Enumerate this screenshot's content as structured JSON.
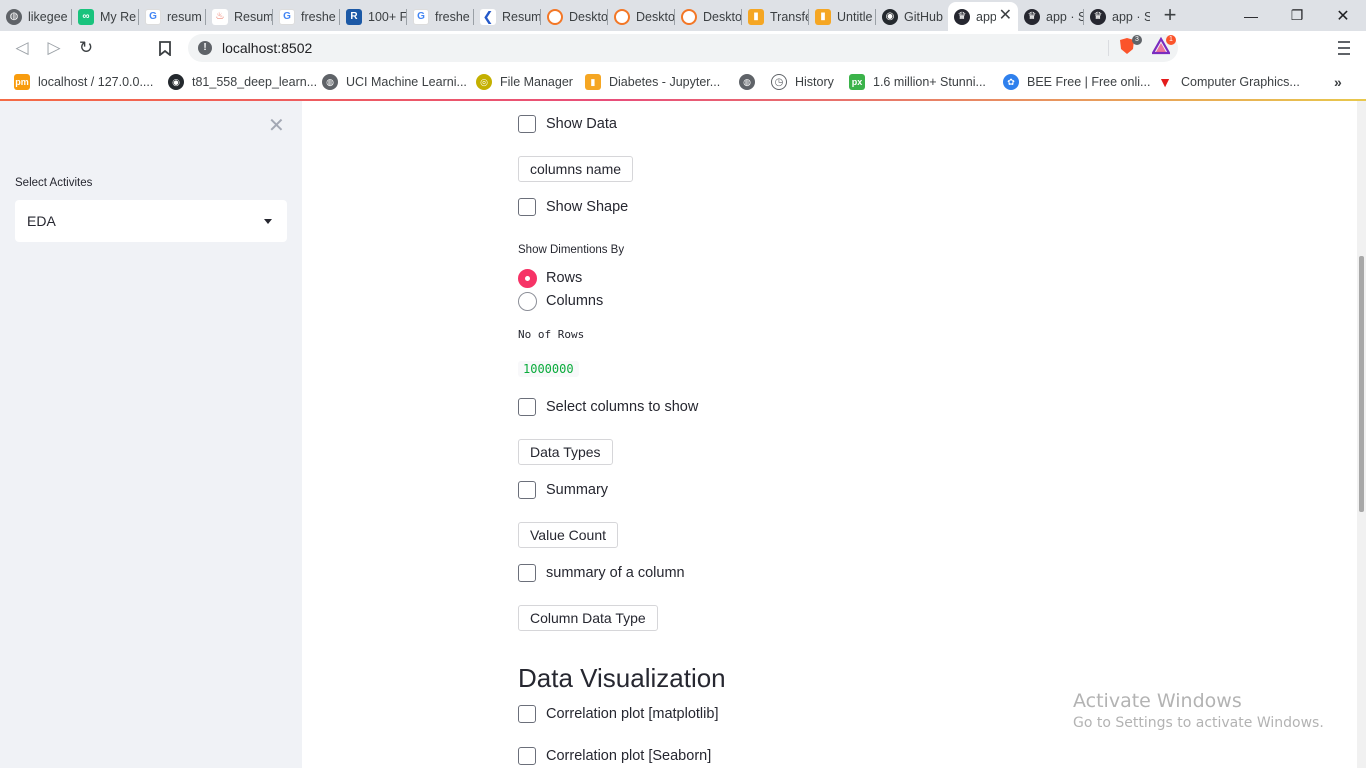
{
  "browser": {
    "tabs": [
      {
        "title": "likegee",
        "color": "#5f6368",
        "icon": "globe-icon"
      },
      {
        "title": "My Re",
        "color": "#19c37d",
        "icon": "infinity-icon"
      },
      {
        "title": "resum",
        "color": "#4285f4",
        "icon": "google-icon"
      },
      {
        "title": "Resum",
        "color": "#e5533d",
        "icon": "flame-icon"
      },
      {
        "title": "freshe",
        "color": "#4285f4",
        "icon": "google-icon"
      },
      {
        "title": "100+ F",
        "color": "#1c59a6",
        "icon": "r-icon"
      },
      {
        "title": "freshe",
        "color": "#4285f4",
        "icon": "google-icon"
      },
      {
        "title": "Resum",
        "color": "#2559c9",
        "icon": "k-icon"
      },
      {
        "title": "Deskto",
        "color": "#f37726",
        "icon": "jupyter-icon"
      },
      {
        "title": "Deskto",
        "color": "#f37726",
        "icon": "jupyter-icon"
      },
      {
        "title": "Deskto",
        "color": "#f37726",
        "icon": "jupyter-icon"
      },
      {
        "title": "Transfe",
        "color": "#f5a623",
        "icon": "notebook-icon"
      },
      {
        "title": "Untitle",
        "color": "#f5a623",
        "icon": "notebook-icon"
      },
      {
        "title": "GitHub",
        "color": "#24292e",
        "icon": "github-icon"
      },
      {
        "title": "app",
        "color": "#262730",
        "icon": "streamlit-icon"
      },
      {
        "title": "app · S",
        "color": "#262730",
        "icon": "streamlit-icon"
      },
      {
        "title": "app · S",
        "color": "#262730",
        "icon": "streamlit-icon"
      }
    ],
    "active_tab_index": 14,
    "url": "localhost:8502",
    "extensions": {
      "brave_badge": "3",
      "rewards_badge": "1"
    },
    "bookmarks": [
      {
        "label": "localhost / 127.0.0....",
        "color": "#f89c0e",
        "icon": "phpmyadmin-icon"
      },
      {
        "label": "t81_558_deep_learn...",
        "color": "#24292e",
        "icon": "github-icon"
      },
      {
        "label": "UCI Machine Learni...",
        "color": "#5f6368",
        "icon": "globe-icon"
      },
      {
        "label": "File Manager",
        "color": "#c4b000",
        "icon": "file-manager-icon"
      },
      {
        "label": "Diabetes - Jupyter...",
        "color": "#f5a623",
        "icon": "notebook-icon"
      },
      {
        "label": "",
        "color": "#5f6368",
        "icon": "globe-icon"
      },
      {
        "label": "History",
        "color": "#5f6368",
        "icon": "history-icon"
      },
      {
        "label": "1.6 million+ Stunni...",
        "color": "#3bb34a",
        "icon": "px-icon"
      },
      {
        "label": "BEE Free | Free onli...",
        "color": "#2f80ed",
        "icon": "bee-icon"
      },
      {
        "label": "Computer Graphics...",
        "color": "#e41b1b",
        "icon": "v-icon"
      }
    ]
  },
  "sidebar": {
    "label": "Select Activites",
    "selected": "EDA"
  },
  "main": {
    "show_data": "Show Data",
    "columns_name_btn": "columns name",
    "show_shape": "Show Shape",
    "radio_title": "Show Dimentions By",
    "radio_options": [
      "Rows",
      "Columns"
    ],
    "radio_selected": "Rows",
    "rows_label": "No of Rows",
    "rows_value": "1000000",
    "select_columns": "Select columns to show",
    "data_types_btn": "Data Types",
    "summary": "Summary",
    "value_count_btn": "Value Count",
    "summary_column": "summary of a column",
    "column_dtype_btn": "Column Data Type",
    "section_title": "Data Visualization",
    "corr_matplotlib": "Correlation plot [matplotlib]",
    "corr_seaborn": "Correlation plot [Seaborn]"
  },
  "watermark": {
    "line1": "Activate Windows",
    "line2": "Go to Settings to activate Windows."
  }
}
